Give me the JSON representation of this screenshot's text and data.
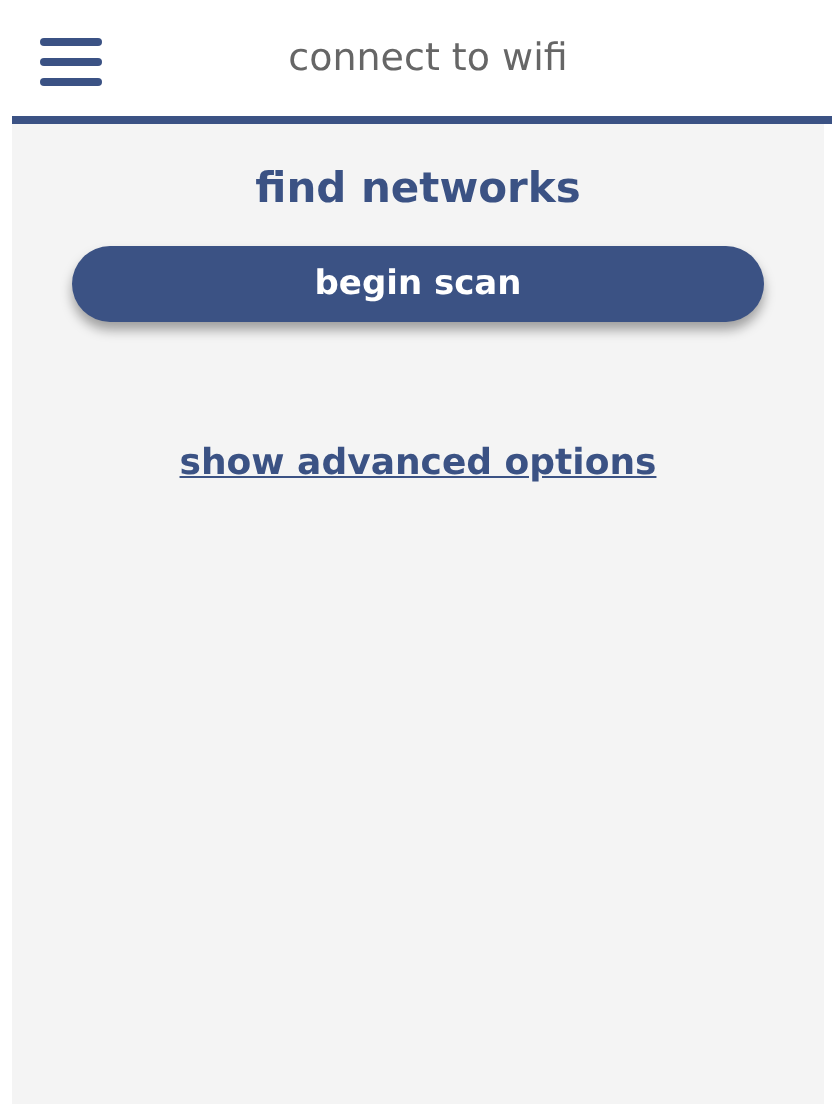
{
  "header": {
    "title": "connect to wifi"
  },
  "heading": "find networks",
  "scan_button": "begin scan",
  "advanced_link": "show advanced options"
}
